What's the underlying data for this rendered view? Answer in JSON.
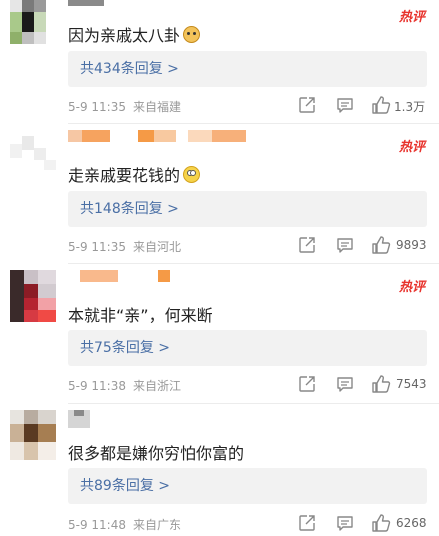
{
  "hot_badge_label": "热评",
  "comments": [
    {
      "text": "因为亲戚太八卦",
      "emoji": "doge-emoji",
      "replies_label": "共434条回复 >",
      "date": "5-9 11:35",
      "location": "来自福建",
      "likes": "1.3万"
    },
    {
      "text": "走亲戚要花钱的",
      "emoji": "eye-roll-emoji",
      "replies_label": "共148条回复 >",
      "date": "5-9 11:35",
      "location": "来自河北",
      "likes": "9893"
    },
    {
      "text": "本就非“亲”，何来断",
      "emoji": "",
      "replies_label": "共75条回复 >",
      "date": "5-9 11:38",
      "location": "来自浙江",
      "likes": "7543"
    },
    {
      "text": "很多都是嫌你穷怕你富的",
      "emoji": "",
      "replies_label": "共89条回复 >",
      "date": "5-9 11:48",
      "location": "来自广东",
      "likes": "6268"
    }
  ],
  "colors": {
    "hot_badge": "#e8332d",
    "reply_link": "#4a6fa5",
    "reply_bg": "#f2f2f2",
    "meta_text": "#999999"
  },
  "icons": [
    "share-icon",
    "comment-icon",
    "like-icon"
  ]
}
